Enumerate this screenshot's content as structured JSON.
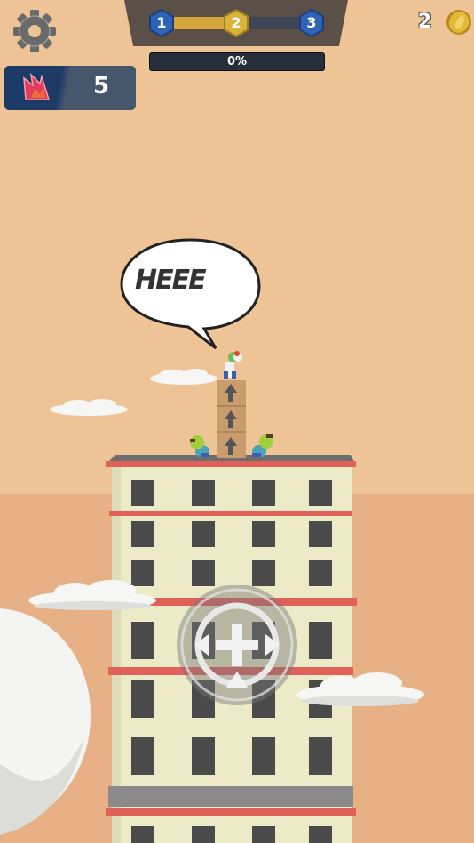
{
  "hud": {
    "settings_icon": "gear-icon",
    "levels": [
      {
        "label": "1",
        "state": "done"
      },
      {
        "label": "2",
        "state": "current"
      },
      {
        "label": "3",
        "state": "next"
      }
    ],
    "level_progress": 0.5,
    "progress_percent": 0,
    "progress_text": "0%",
    "coins": "2",
    "coin_icon": "coin-icon",
    "streak_icon": "fire-icon",
    "streak": "5"
  },
  "scene": {
    "speech_bubble": "HEEE",
    "joystick_icon": "move-joystick-icon"
  },
  "colors": {
    "sky": "#eec497",
    "ground": "#e8b085",
    "building": "#eceac7",
    "roof_trim": "#e0605a",
    "hex_blue": "#2f63b5",
    "hex_gold": "#d9b23a",
    "level_fill": "#d6a63b"
  }
}
